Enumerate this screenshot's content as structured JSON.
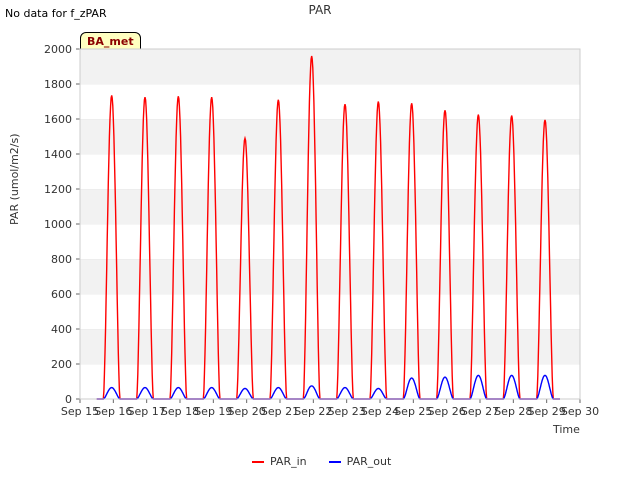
{
  "note": "No data for f_zPAR",
  "tag": "BA_met",
  "chart_data": {
    "type": "line",
    "title": "PAR",
    "xlabel": "Time",
    "ylabel": "PAR (umol/m2/s)",
    "ylim": [
      0,
      2000
    ],
    "xlim": [
      15,
      30
    ],
    "yticks": [
      0,
      200,
      400,
      600,
      800,
      1000,
      1200,
      1400,
      1600,
      1800,
      2000
    ],
    "xticks": [
      {
        "value": 15,
        "label": "Sep 15"
      },
      {
        "value": 16,
        "label": "Sep 16"
      },
      {
        "value": 17,
        "label": "Sep 17"
      },
      {
        "value": 18,
        "label": "Sep 18"
      },
      {
        "value": 19,
        "label": "Sep 19"
      },
      {
        "value": 20,
        "label": "Sep 20"
      },
      {
        "value": 21,
        "label": "Sep 21"
      },
      {
        "value": 22,
        "label": "Sep 22"
      },
      {
        "value": 23,
        "label": "Sep 23"
      },
      {
        "value": 24,
        "label": "Sep 24"
      },
      {
        "value": 25,
        "label": "Sep 25"
      },
      {
        "value": 26,
        "label": "Sep 26"
      },
      {
        "value": 27,
        "label": "Sep 27"
      },
      {
        "value": 28,
        "label": "Sep 28"
      },
      {
        "value": 29,
        "label": "Sep 29"
      },
      {
        "value": 30,
        "label": "Sep 30"
      }
    ],
    "grid": "horizontal bands",
    "legend": "bottom-center",
    "series": [
      {
        "name": "PAR_in",
        "color": "#ff0000",
        "days": [
          16,
          17,
          18,
          19,
          20,
          21,
          22,
          23,
          24,
          25,
          26,
          27,
          28,
          29
        ],
        "peaks": [
          1735,
          1725,
          1730,
          1725,
          1490,
          1710,
          1960,
          1685,
          1700,
          1690,
          1650,
          1625,
          1620,
          1595
        ]
      },
      {
        "name": "PAR_out",
        "color": "#0000ff",
        "days": [
          16,
          17,
          18,
          19,
          20,
          21,
          22,
          23,
          24,
          25,
          26,
          27,
          28,
          29
        ],
        "peaks": [
          65,
          65,
          65,
          65,
          60,
          65,
          75,
          65,
          60,
          120,
          125,
          135,
          135,
          135
        ]
      }
    ]
  }
}
